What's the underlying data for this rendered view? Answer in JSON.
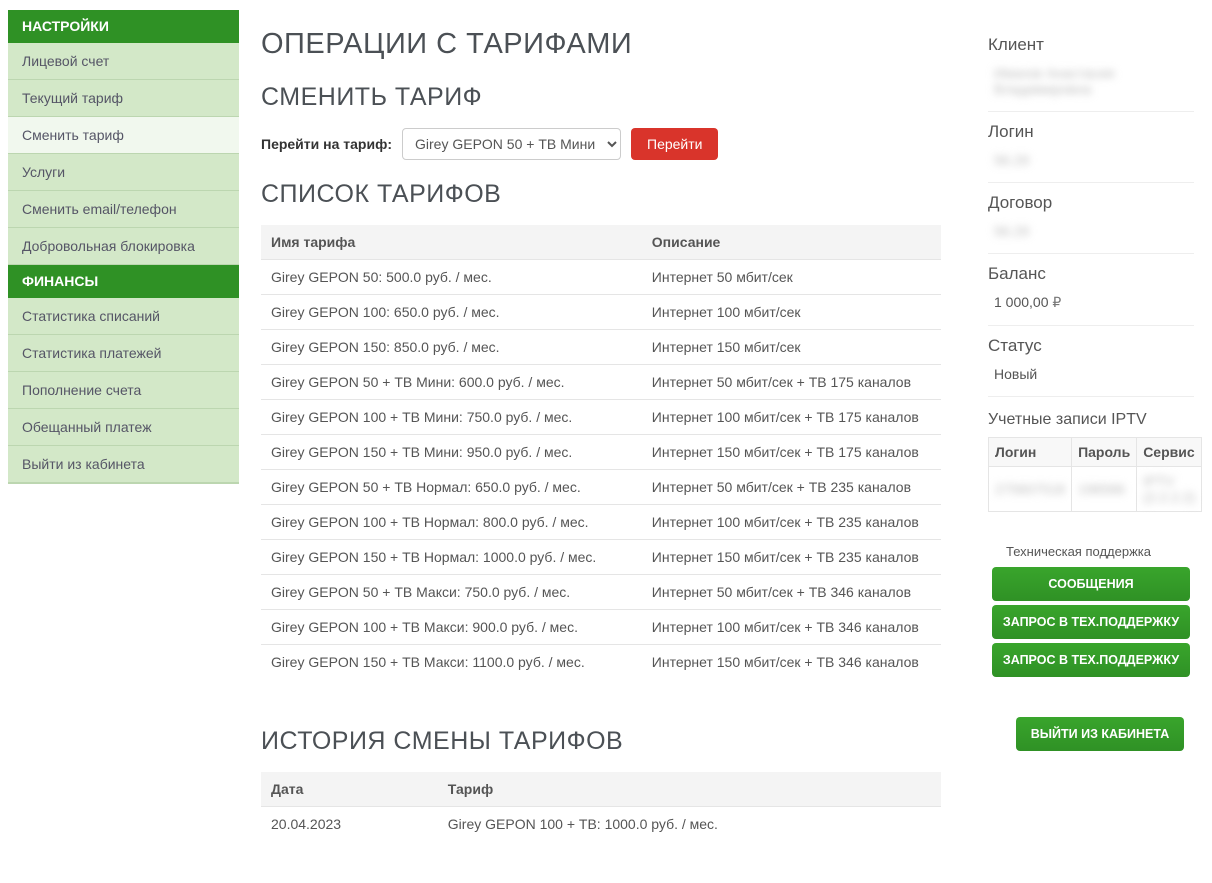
{
  "sidebar": {
    "settings_header": "НАСТРОЙКИ",
    "settings_items": [
      "Лицевой счет",
      "Текущий тариф",
      "Сменить тариф",
      "Услуги",
      "Сменить email/телефон",
      "Добровольная блокировка"
    ],
    "settings_active_index": 2,
    "finance_header": "ФИНАНСЫ",
    "finance_items": [
      "Статистика списаний",
      "Статистика платежей",
      "Пополнение счета",
      "Обещанный платеж",
      "Выйти из кабинета"
    ]
  },
  "main": {
    "title": "ОПЕРАЦИИ С ТАРИФАМИ",
    "change_title": "СМЕНИТЬ ТАРИФ",
    "change_label": "Перейти на тариф:",
    "select_value": "Girey GEPON 50 + ТВ Мини",
    "go_button": "Перейти",
    "list_title": "СПИСОК ТАРИФОВ",
    "col_name": "Имя тарифа",
    "col_desc": "Описание",
    "tariffs": [
      {
        "name": "Girey GEPON 50: 500.0 руб. / мес.",
        "desc": "Интернет 50 мбит/сек"
      },
      {
        "name": "Girey GEPON 100: 650.0 руб. / мес.",
        "desc": "Интернет 100 мбит/сек"
      },
      {
        "name": "Girey GEPON 150: 850.0 руб. / мес.",
        "desc": "Интернет 150 мбит/сек"
      },
      {
        "name": "Girey GEPON 50 + ТВ Мини: 600.0 руб. / мес.",
        "desc": "Интернет 50 мбит/сек + ТВ 175 каналов"
      },
      {
        "name": "Girey GEPON 100 + ТВ Мини: 750.0 руб. / мес.",
        "desc": "Интернет 100 мбит/сек + ТВ 175 каналов"
      },
      {
        "name": "Girey GEPON 150 + ТВ Мини: 950.0 руб. / мес.",
        "desc": "Интернет 150 мбит/сек + ТВ 175 каналов"
      },
      {
        "name": "Girey GEPON 50 + ТВ Нормал: 650.0 руб. / мес.",
        "desc": "Интернет 50 мбит/сек + ТВ 235 каналов"
      },
      {
        "name": "Girey GEPON 100 + ТВ Нормал: 800.0 руб. / мес.",
        "desc": "Интернет 100 мбит/сек + ТВ 235 каналов"
      },
      {
        "name": "Girey GEPON 150 + ТВ Нормал: 1000.0 руб. / мес.",
        "desc": "Интернет 150 мбит/сек + ТВ 235 каналов"
      },
      {
        "name": "Girey GEPON 50 + ТВ Макси: 750.0 руб. / мес.",
        "desc": "Интернет 50 мбит/сек + ТВ 346 каналов"
      },
      {
        "name": "Girey GEPON 100 + ТВ Макси: 900.0 руб. / мес.",
        "desc": "Интернет 100 мбит/сек + ТВ 346 каналов"
      },
      {
        "name": "Girey GEPON 150 + ТВ Макси: 1100.0 руб. / мес.",
        "desc": "Интернет 150 мбит/сек + ТВ 346 каналов"
      }
    ],
    "history_title": "ИСТОРИЯ СМЕНЫ ТАРИФОВ",
    "history_col_date": "Дата",
    "history_col_tariff": "Тариф",
    "history": [
      {
        "date": "20.04.2023",
        "tariff": "Girey GEPON 100 + ТВ: 1000.0 руб. / мес."
      }
    ]
  },
  "right": {
    "client_label": "Клиент",
    "client_value": "Иванов Анастасия Владимировна",
    "login_label": "Логин",
    "login_value": "56.29",
    "contract_label": "Договор",
    "contract_value": "56.29",
    "balance_label": "Баланс",
    "balance_value": "1 000,00",
    "status_label": "Статус",
    "status_value": "Новый",
    "iptv_title": "Учетные записи IPTV",
    "iptv_col_login": "Логин",
    "iptv_col_password": "Пароль",
    "iptv_col_service": "Сервис",
    "iptv_row": {
      "login": "275607518",
      "password": "196566",
      "service": "IPTV (2.2.2.2)"
    },
    "support_label": "Техническая поддержка",
    "btn_messages": "СООБЩЕНИЯ",
    "btn_support1": "ЗАПРОС В ТЕХ.ПОДДЕРЖКУ",
    "btn_support2": "ЗАПРОС В ТЕХ.ПОДДЕРЖКУ",
    "btn_logout": "ВЫЙТИ ИЗ КАБИНЕТА"
  }
}
